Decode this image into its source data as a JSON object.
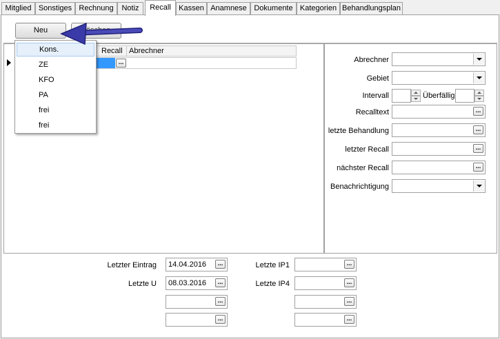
{
  "tabs": [
    {
      "label": "Mitglied"
    },
    {
      "label": "Sonstiges"
    },
    {
      "label": "Rechnung"
    },
    {
      "label": "Notiz"
    },
    {
      "label": "Recall",
      "active": true
    },
    {
      "label": "Kassen"
    },
    {
      "label": "Anamnese"
    },
    {
      "label": "Dokumente"
    },
    {
      "label": "Kategorien"
    },
    {
      "label": "Behandlungsplan"
    }
  ],
  "toolbar": {
    "new_label": "Neu",
    "delete_label": "Löschen"
  },
  "grid": {
    "columns": [
      "Recall",
      "Abrechner"
    ]
  },
  "dropdown_menu": {
    "items": [
      "Kons.",
      "ZE",
      "KFO",
      "PA",
      "frei",
      "frei"
    ],
    "highlighted": "Kons."
  },
  "form": {
    "abrechner_label": "Abrechner",
    "gebiet_label": "Gebiet",
    "intervall_label": "Intervall",
    "ueberfaellig_label": "Überfällig",
    "recalltext_label": "Recalltext",
    "letzte_behandlung_label": "letzte Behandlung",
    "letzter_recall_label": "letzter Recall",
    "naechster_recall_label": "nächster Recall",
    "benachrichtigung_label": "Benachrichtigung"
  },
  "footer": {
    "letzter_eintrag_label": "Letzter Eintrag",
    "letzter_eintrag_value": "14.04.2016",
    "letzte_u_label": "Letzte U",
    "letzte_u_value": "08.03.2016",
    "letzte_ip1_label": "Letzte IP1",
    "letzte_ip4_label": "Letzte IP4"
  },
  "colors": {
    "arrow": "#3a3aa8",
    "selection": "#3399ff"
  }
}
